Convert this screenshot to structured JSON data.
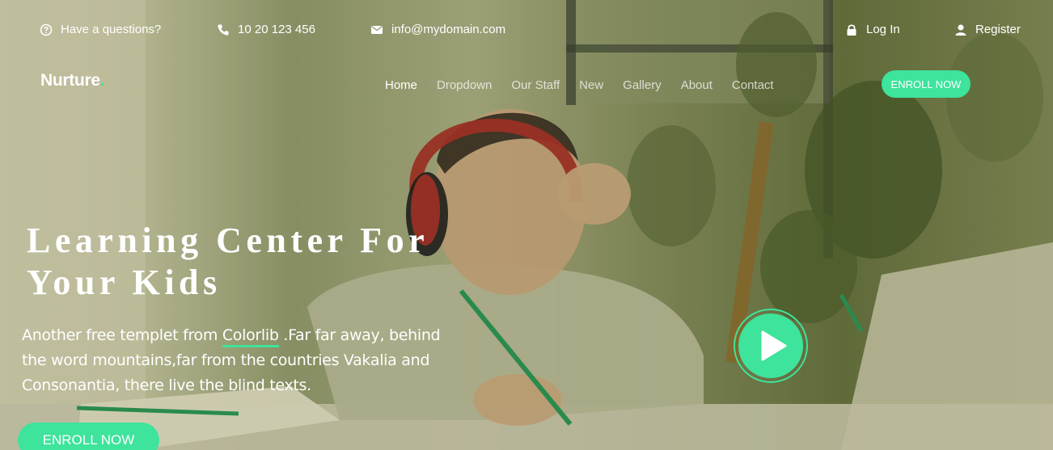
{
  "topbar": {
    "question": {
      "icon": "question-circle-icon",
      "text": "Have a questions?"
    },
    "phone": {
      "icon": "phone-icon",
      "text": "10 20 123 456"
    },
    "email": {
      "icon": "envelope-icon",
      "text": "info@mydomain.com"
    },
    "login": {
      "icon": "lock-icon",
      "text": "Log In"
    },
    "register": {
      "icon": "user-icon",
      "text": "Register"
    }
  },
  "brand": {
    "name": "Nurture",
    "dot": "."
  },
  "nav": {
    "items": [
      {
        "label": "Home",
        "active": true
      },
      {
        "label": "Dropdown",
        "active": false
      },
      {
        "label": "Our Staff",
        "active": false
      },
      {
        "label": "New",
        "active": false
      },
      {
        "label": "Gallery",
        "active": false
      },
      {
        "label": "About",
        "active": false
      },
      {
        "label": "Contact",
        "active": false
      }
    ],
    "enroll_label": "ENROLL NOW"
  },
  "hero": {
    "title_line1": "Learning Center For",
    "title_line2": "Your Kids",
    "desc_before": "Another free templet from ",
    "desc_link": "Colorlib",
    "desc_after": " .Far far away, behind the word mountains,far from the countries Vakalia and Consonantia, there live the blind texts.",
    "enroll_label": "ENROLL NOW",
    "play_icon": "play-icon"
  },
  "colors": {
    "accent": "#3ee39c",
    "text": "#ffffff"
  }
}
